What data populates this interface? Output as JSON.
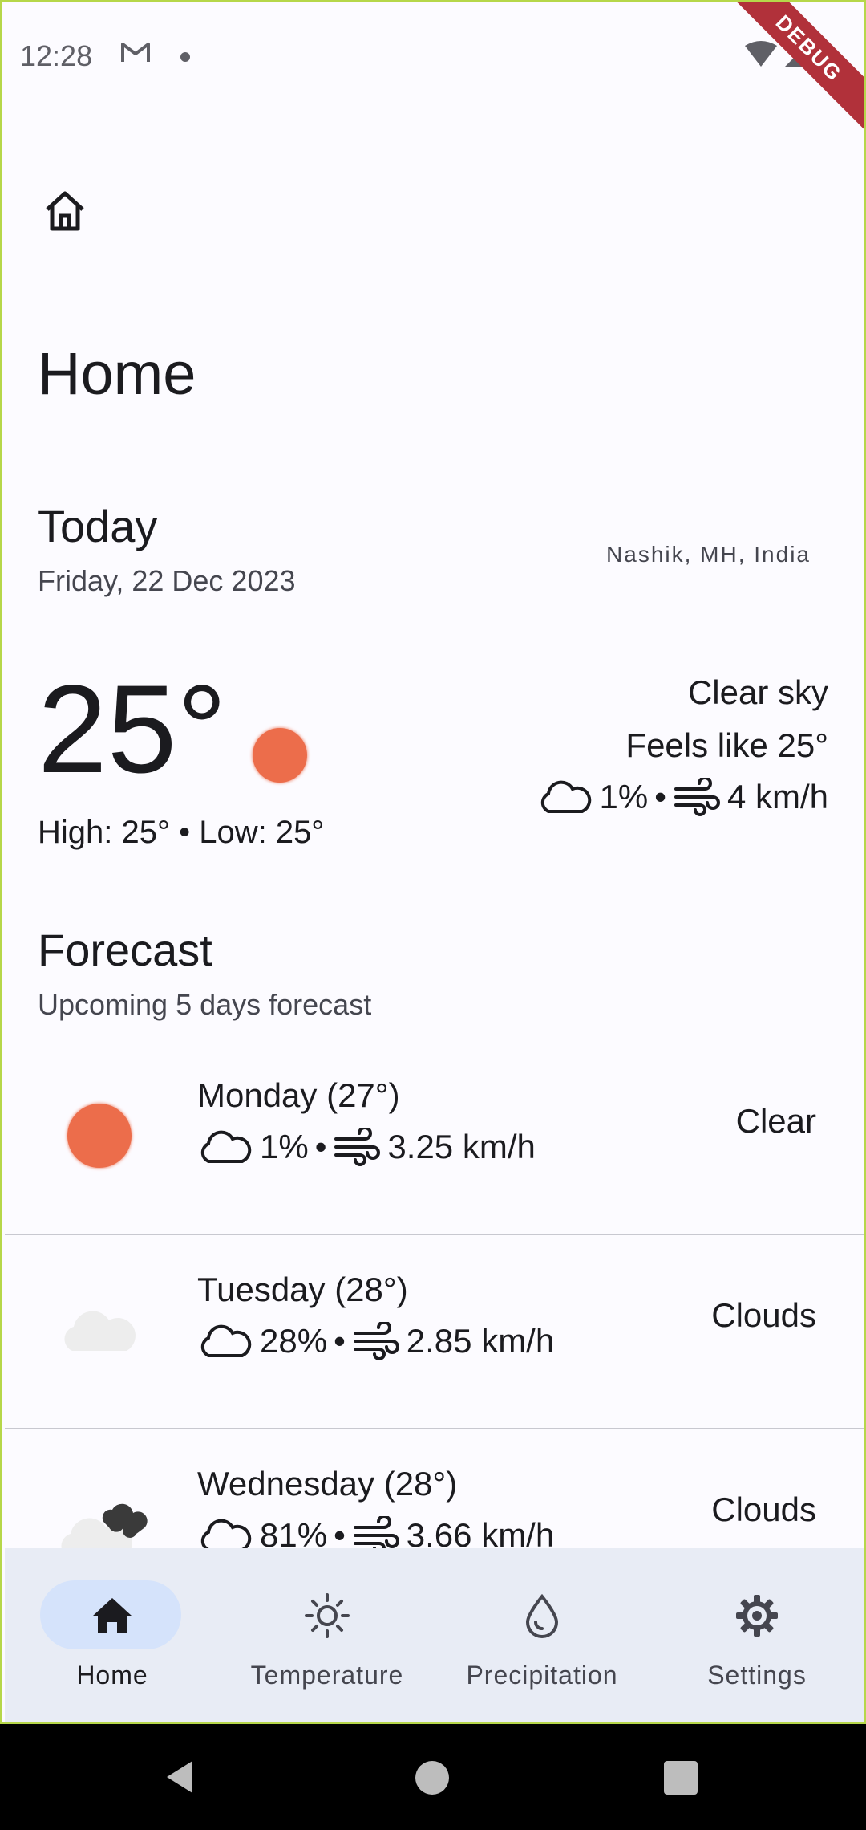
{
  "status_bar": {
    "time": "12:28",
    "debug_banner": "DEBUG"
  },
  "page": {
    "title": "Home"
  },
  "today": {
    "title": "Today",
    "date": "Friday, 22 Dec 2023",
    "location": "Nashik, MH, India",
    "temperature": "25°",
    "high_low": "High: 25° • Low: 25°",
    "condition": "Clear sky",
    "feels_like": "Feels like 25°",
    "cloud": "1%",
    "separator": "•",
    "wind": "4 km/h"
  },
  "forecast": {
    "title": "Forecast",
    "subtitle": "Upcoming 5 days forecast",
    "days": [
      {
        "day": "Monday (27°)",
        "cloud": "1%",
        "sep": "•",
        "wind": "3.25 km/h",
        "status": "Clear",
        "icon": "sun-icon"
      },
      {
        "day": "Tuesday (28°)",
        "cloud": "28%",
        "sep": "•",
        "wind": "2.85 km/h",
        "status": "Clouds",
        "icon": "cloud-icon"
      },
      {
        "day": "Wednesday (28°)",
        "cloud": "81%",
        "sep": "•",
        "wind": "3.66 km/h",
        "status": "Clouds",
        "icon": "dark-cloud-icon"
      }
    ]
  },
  "nav": {
    "items": [
      {
        "label": "Home",
        "icon": "home-icon",
        "active": true
      },
      {
        "label": "Temperature",
        "icon": "sun-outline-icon",
        "active": false
      },
      {
        "label": "Precipitation",
        "icon": "drop-icon",
        "active": false
      },
      {
        "label": "Settings",
        "icon": "gear-icon",
        "active": false
      }
    ]
  },
  "colors": {
    "accent_sun": "#ec6d4b",
    "nav_bg": "#e8ecf5",
    "nav_pill": "#d5e3fb",
    "border": "#b6d74a"
  }
}
